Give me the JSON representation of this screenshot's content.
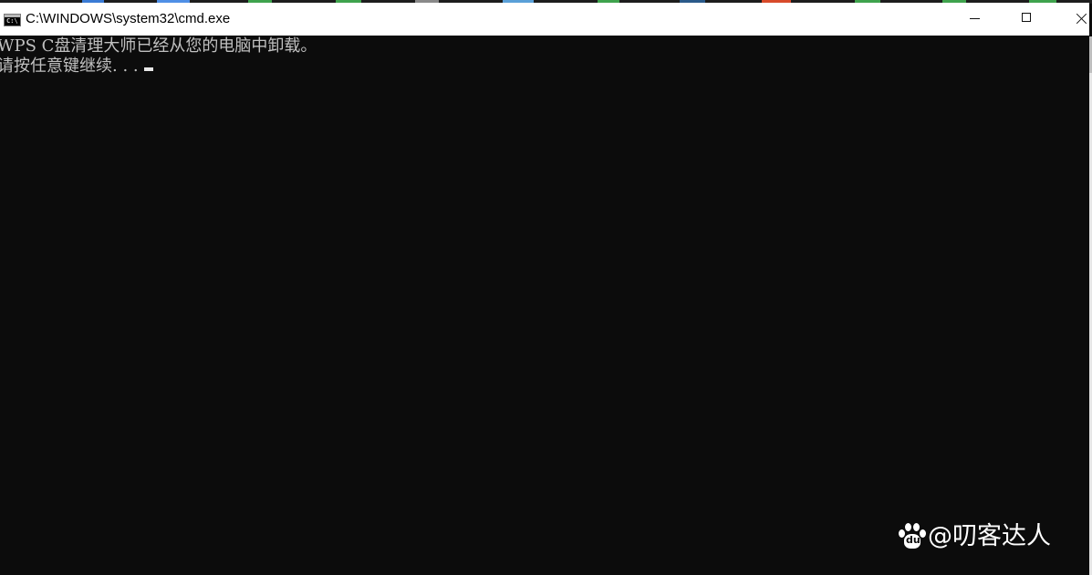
{
  "window": {
    "title": "C:\\WINDOWS\\system32\\cmd.exe",
    "icon": "cmd-console-icon",
    "icon_text": "C:\\"
  },
  "controls": {
    "minimize_icon": "minimize-icon",
    "maximize_icon": "maximize-icon",
    "close_icon": "close-icon"
  },
  "console": {
    "line1": "WPS C盘清理大师已经从您的电脑中卸载。",
    "line2": "请按任意键继续. . ."
  },
  "watermark": {
    "logo_icon": "baidu-paw-icon",
    "logo_text": "du",
    "text": "@叨客达人"
  },
  "colors": {
    "console_bg": "#0c0c0c",
    "console_fg": "#c0c0c0",
    "titlebar_bg": "#ffffff"
  }
}
